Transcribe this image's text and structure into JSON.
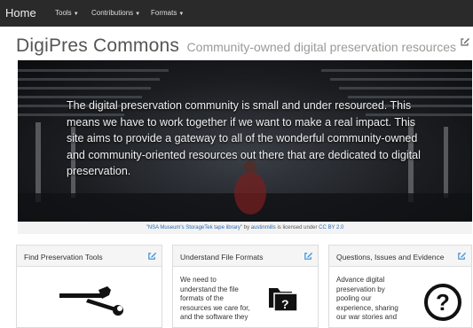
{
  "navbar": {
    "brand": "Home",
    "items": [
      {
        "label": "Tools"
      },
      {
        "label": "Contributions"
      },
      {
        "label": "Formats"
      }
    ]
  },
  "page": {
    "title": "DigiPres Commons",
    "subtitle": "Community-owned digital preservation resources"
  },
  "hero": {
    "text": "The digital preservation community is small and under resourced. This means we have to work together if we want to make a real impact. This site aims to provide a gateway to all of the wonderful community-owned and community-oriented resources out there that are dedicated to digital preservation."
  },
  "credit": {
    "work": "\"NSA Museum's StorageTek tape library\"",
    "by": "by",
    "author": "austinmills",
    "license_text": "is licensed under",
    "license": "CC BY 2.0"
  },
  "cards": [
    {
      "title": "Find Preservation Tools",
      "icon": "tools-icon",
      "text": ""
    },
    {
      "title": "Understand File Formats",
      "icon": "unknown-file-icon",
      "lines": [
        "We need to",
        "understand the file",
        "formats of the",
        "resources we care for,",
        "and the software they"
      ]
    },
    {
      "title": "Questions, Issues and Evidence",
      "icon": "question-icon",
      "lines": [
        "Advance digital",
        "preservation by",
        "pooling our",
        "experience, sharing",
        "our war stories and"
      ]
    }
  ],
  "colors": {
    "navbar": "#2a2a2a",
    "link": "#2a6bb8",
    "edit_icon": "#3a8fd9"
  }
}
